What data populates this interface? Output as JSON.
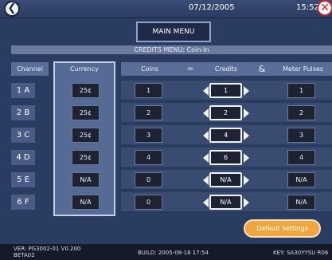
{
  "header": {
    "date": "07/12/2005",
    "time": "15:52",
    "back_icon": "back-arrow-icon",
    "close_icon": "close-icon"
  },
  "menu": {
    "main_menu_label": "MAIN MENU"
  },
  "credits_menu_title": "CREDITS MENU:  Coin-In",
  "columns": {
    "channel": "Channel",
    "currency": "Currency",
    "coins": "Coins",
    "equals": "=",
    "credits": "Credits",
    "ampersand": "&",
    "meter_pulses": "Meter Pulses"
  },
  "rows": [
    {
      "channel": "1 A",
      "currency": "25¢",
      "coins": "1",
      "credits": "1",
      "meter_pulses": "1"
    },
    {
      "channel": "2 B",
      "currency": "25¢",
      "coins": "2",
      "credits": "2",
      "meter_pulses": "2"
    },
    {
      "channel": "3 C",
      "currency": "25¢",
      "coins": "3",
      "credits": "4",
      "meter_pulses": "3"
    },
    {
      "channel": "4 D",
      "currency": "25¢",
      "coins": "4",
      "credits": "6",
      "meter_pulses": "4"
    },
    {
      "channel": "5 E",
      "currency": "N/A",
      "coins": "0",
      "credits": "N/A",
      "meter_pulses": "N/A"
    },
    {
      "channel": "6 F",
      "currency": "N/A",
      "coins": "0",
      "credits": "N/A",
      "meter_pulses": "N/A"
    }
  ],
  "default_settings_label": "Default Settings",
  "footer": {
    "ver_line1": "VER:  PG3002-01 V0.200",
    "ver_line2": "BETA02",
    "build": "BUILD:  2005-08-18  17:54",
    "key": "KEY:  SA30YYSU R06"
  },
  "colors": {
    "background": "#2a3c61",
    "header_cell": "#5a6d98",
    "dark_field": "#1d2332",
    "accent_button": "#f0a640",
    "close_red": "#c62a2a"
  }
}
